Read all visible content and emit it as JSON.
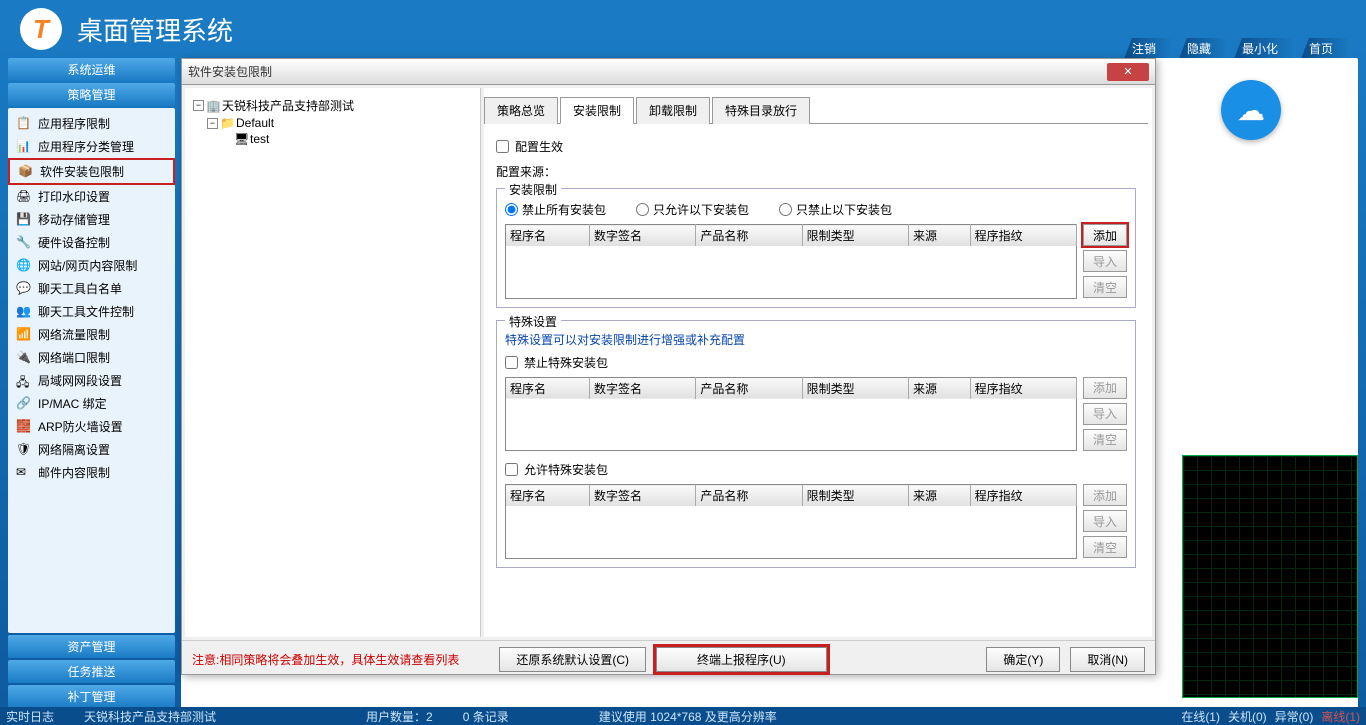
{
  "app_title": "桌面管理系统",
  "top_nav": [
    "注销",
    "隐藏",
    "最小化",
    "首页"
  ],
  "sidebar": {
    "headers": [
      "系统运维",
      "策略管理"
    ],
    "items": [
      {
        "label": "应用程序限制",
        "active": false
      },
      {
        "label": "应用程序分类管理",
        "active": false
      },
      {
        "label": "软件安装包限制",
        "active": true
      },
      {
        "label": "打印水印设置",
        "active": false
      },
      {
        "label": "移动存储管理",
        "active": false
      },
      {
        "label": "硬件设备控制",
        "active": false
      },
      {
        "label": "网站/网页内容限制",
        "active": false
      },
      {
        "label": "聊天工具白名单",
        "active": false
      },
      {
        "label": "聊天工具文件控制",
        "active": false
      },
      {
        "label": "网络流量限制",
        "active": false
      },
      {
        "label": "网络端口限制",
        "active": false
      },
      {
        "label": "局域网网段设置",
        "active": false
      },
      {
        "label": "IP/MAC 绑定",
        "active": false
      },
      {
        "label": "ARP防火墙设置",
        "active": false
      },
      {
        "label": "网络隔离设置",
        "active": false
      },
      {
        "label": "邮件内容限制",
        "active": false
      }
    ],
    "footers": [
      "资产管理",
      "任务推送",
      "补丁管理"
    ]
  },
  "dialog": {
    "title": "软件安装包限制",
    "tree": {
      "root": "天锐科技产品支持部测试",
      "child1": "Default",
      "child2": "test"
    },
    "tabs": [
      "策略总览",
      "安装限制",
      "卸载限制",
      "特殊目录放行"
    ],
    "active_tab": "安装限制",
    "enable_config": "配置生效",
    "config_src_label": "配置来源：",
    "install_restriction": {
      "title": "安装限制",
      "radios": [
        "禁止所有安装包",
        "只允许以下安装包",
        "只禁止以下安装包"
      ],
      "columns": [
        "程序名",
        "数字签名",
        "产品名称",
        "限制类型",
        "来源",
        "程序指纹"
      ],
      "buttons": [
        "添加",
        "导入",
        "清空"
      ]
    },
    "special": {
      "title": "特殊设置",
      "note": "特殊设置可以对安装限制进行增强或补充配置",
      "forbid_label": "禁止特殊安装包",
      "allow_label": "允许特殊安装包",
      "columns": [
        "程序名",
        "数字签名",
        "产品名称",
        "限制类型",
        "来源",
        "程序指纹"
      ],
      "buttons": [
        "添加",
        "导入",
        "清空"
      ]
    },
    "footer": {
      "note": "注意:相同策略将会叠加生效，具体生效请查看列表",
      "restore": "还原系统默认设置(C)",
      "report": "终端上报程序(U)",
      "ok": "确定(Y)",
      "cancel": "取消(N)"
    }
  },
  "statusbar": {
    "log": "实时日志",
    "org": "天锐科技产品支持部测试",
    "users": "用户数量：2",
    "records": "0 条记录",
    "suggest": "建议使用 1024*768 及更高分辨率",
    "online": "在线(1)",
    "shutdown": "关机(0)",
    "abnormal": "异常(0)",
    "offline": "离线(1)"
  }
}
